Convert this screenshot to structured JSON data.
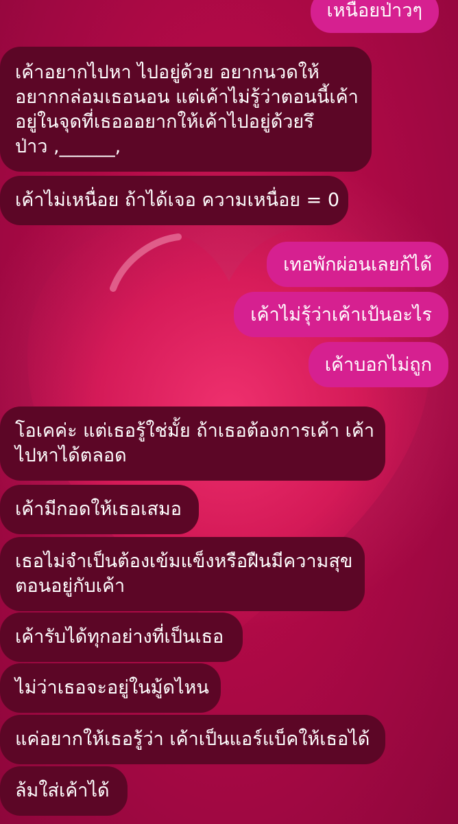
{
  "colors": {
    "background": "#b40a47",
    "incoming_bubble": "#5c0626",
    "outgoing_bubble": "#d62090",
    "text": "#ffffff"
  },
  "messages": [
    {
      "id": "m1",
      "side": "outgoing",
      "lines": [
        "เหนื่อยป่าวๆ"
      ]
    },
    {
      "id": "m2",
      "side": "incoming",
      "lines": [
        "เค้าอยากไปหา ไปอยู่ด้วย อยากนวดให้",
        "อยากกล่อมเธอนอน แต่เค้าไม่รู้ว่าตอนนี้เค้า",
        "อยู่ในจุดที่เธอออยากให้เค้าไปอยู่ด้วยรึ",
        "ป่าว ,______,"
      ]
    },
    {
      "id": "m3",
      "side": "incoming",
      "lines": [
        "เค้าไม่เหนื่อย ถ้าได้เจอ ความเหนื่อย = 0"
      ]
    },
    {
      "id": "m4",
      "side": "outgoing",
      "lines": [
        "เทอพักผ่อนเลยก้ได้"
      ]
    },
    {
      "id": "m5",
      "side": "outgoing",
      "lines": [
        "เค้าไม่รุ้ว่าเค้าเป้นอะไร"
      ]
    },
    {
      "id": "m6",
      "side": "outgoing",
      "lines": [
        "เค้าบอกไม่ถูก"
      ]
    },
    {
      "id": "m7",
      "side": "incoming",
      "lines": [
        "โอเคค่ะ แต่เธอรู้ใช่มั้ย ถ้าเธอต้องการเค้า เค้า",
        "ไปหาได้ตลอด"
      ]
    },
    {
      "id": "m8",
      "side": "incoming",
      "lines": [
        "เค้ามีกอดให้เธอเสมอ"
      ]
    },
    {
      "id": "m9",
      "side": "incoming",
      "lines": [
        "เธอไม่จำเป็นต้องเข้มแข็งหรือฝืนมีความสุข",
        "ตอนอยู่กับเค้า"
      ]
    },
    {
      "id": "m10",
      "side": "incoming",
      "lines": [
        "เค้ารับได้ทุกอย่างที่เป็นเธอ"
      ]
    },
    {
      "id": "m11",
      "side": "incoming",
      "lines": [
        "ไม่ว่าเธอจะอยู่ในมู้ดไหน"
      ]
    },
    {
      "id": "m12",
      "side": "incoming",
      "lines": [
        "แค่อยากให้เธอรู้ว่า เค้าเป็นแอร์แบ็คให้เธอได้"
      ]
    },
    {
      "id": "m13",
      "side": "incoming",
      "lines": [
        "ล้มใส่เค้าได้"
      ]
    }
  ]
}
